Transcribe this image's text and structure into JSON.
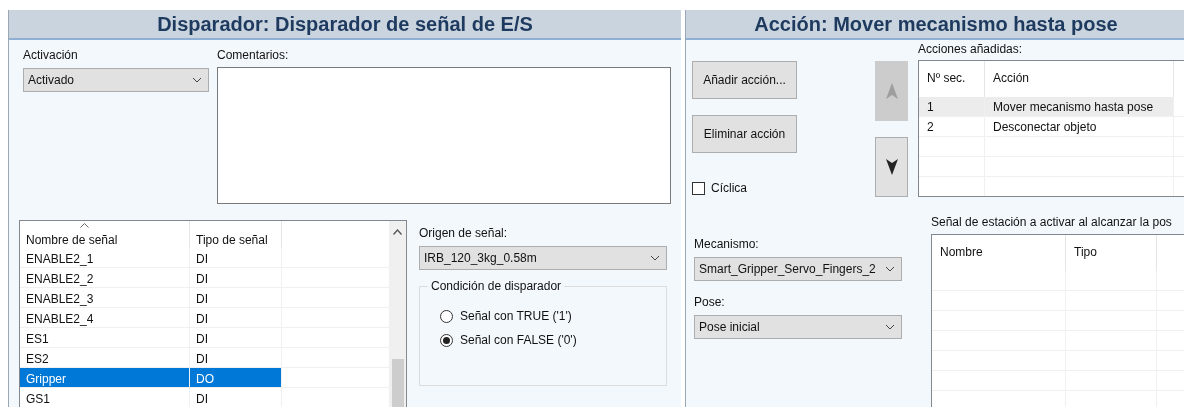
{
  "trigger_panel": {
    "title": "Disparador: Disparador de señal de E/S",
    "activation": {
      "label": "Activación",
      "value": "Activado"
    },
    "comments": {
      "label": "Comentarios:"
    },
    "signal_list": {
      "columns": [
        "Nombre de señal",
        "Tipo de señal"
      ],
      "rows": [
        {
          "name": "ENABLE2_1",
          "type": "DI",
          "selected": false
        },
        {
          "name": "ENABLE2_2",
          "type": "DI",
          "selected": false
        },
        {
          "name": "ENABLE2_3",
          "type": "DI",
          "selected": false
        },
        {
          "name": "ENABLE2_4",
          "type": "DI",
          "selected": false
        },
        {
          "name": "ES1",
          "type": "DI",
          "selected": false
        },
        {
          "name": "ES2",
          "type": "DI",
          "selected": false
        },
        {
          "name": "Gripper",
          "type": "DO",
          "selected": true
        },
        {
          "name": "GS1",
          "type": "DI",
          "selected": false
        }
      ]
    },
    "signal_source": {
      "label": "Origen de señal:",
      "value": "IRB_120_3kg_0.58m"
    },
    "trigger_condition": {
      "label": "Condición de disparador",
      "options": [
        {
          "label": "Señal con TRUE ('1')",
          "selected": false
        },
        {
          "label": "Señal con FALSE ('0')",
          "selected": true
        }
      ]
    }
  },
  "action_panel": {
    "title": "Acción: Mover mecanismo hasta pose",
    "buttons": [
      "Añadir acción...",
      "Eliminar acción"
    ],
    "cyclic": {
      "label": "Cíclica",
      "checked": false
    },
    "move_up": {
      "disabled": true
    },
    "move_down": {
      "disabled": false
    },
    "added_actions": {
      "label": "Acciones añadidas:",
      "columns": [
        "Nº sec.",
        "Acción"
      ],
      "rows": [
        {
          "seq": "1",
          "action": "Mover mecanismo hasta pose",
          "selected": true
        },
        {
          "seq": "2",
          "action": "Desconectar objeto",
          "selected": false
        }
      ]
    },
    "mechanism": {
      "label": "Mecanismo:",
      "value": "Smart_Gripper_Servo_Fingers_2"
    },
    "pose": {
      "label": "Pose:",
      "value": "Pose inicial"
    },
    "station_signals": {
      "label": "Señal de estación a activar al alcanzar la pos",
      "columns": [
        "Nombre",
        "Tipo"
      ]
    }
  }
}
